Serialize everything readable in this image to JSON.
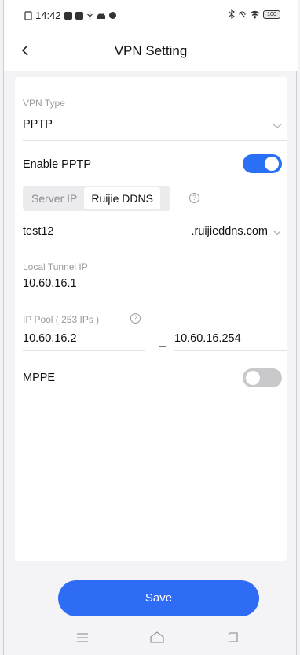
{
  "status_bar": {
    "time": "14:42",
    "battery": "100",
    "icons_left": [
      "sim-icon",
      "app-icon",
      "app-icon",
      "usb-icon",
      "cloud-icon",
      "alert-icon"
    ],
    "icons_right": [
      "bluetooth-icon",
      "mute-icon",
      "wifi-icon",
      "battery-icon"
    ]
  },
  "header": {
    "back_icon": "chevron-left-icon",
    "title": "VPN Setting"
  },
  "form": {
    "vpn_type_label": "VPN Type",
    "vpn_type_value": "PPTP",
    "enable_label": "Enable PPTP",
    "enable_on": true,
    "server_tabs": [
      "Server IP",
      "Ruijie DDNS"
    ],
    "server_tab_active": 1,
    "ddns_prefix": "test12",
    "ddns_suffix": ".ruijieddns.com",
    "local_tunnel_label": "Local Tunnel IP",
    "local_tunnel_value": "10.60.16.1",
    "ip_pool_label": "IP Pool ( 253  IPs )",
    "ip_pool_start": "10.60.16.2",
    "ip_pool_end": "10.60.16.254",
    "mppe_label": "MPPE",
    "mppe_on": false,
    "help_glyph": "?"
  },
  "actions": {
    "save_label": "Save"
  },
  "navbar": {
    "items": [
      "menu-icon",
      "home-icon",
      "back-icon"
    ]
  },
  "colors": {
    "accent": "#2e6cf6",
    "toggle_on": "#2970f5",
    "toggle_off": "#c9c9cc"
  }
}
